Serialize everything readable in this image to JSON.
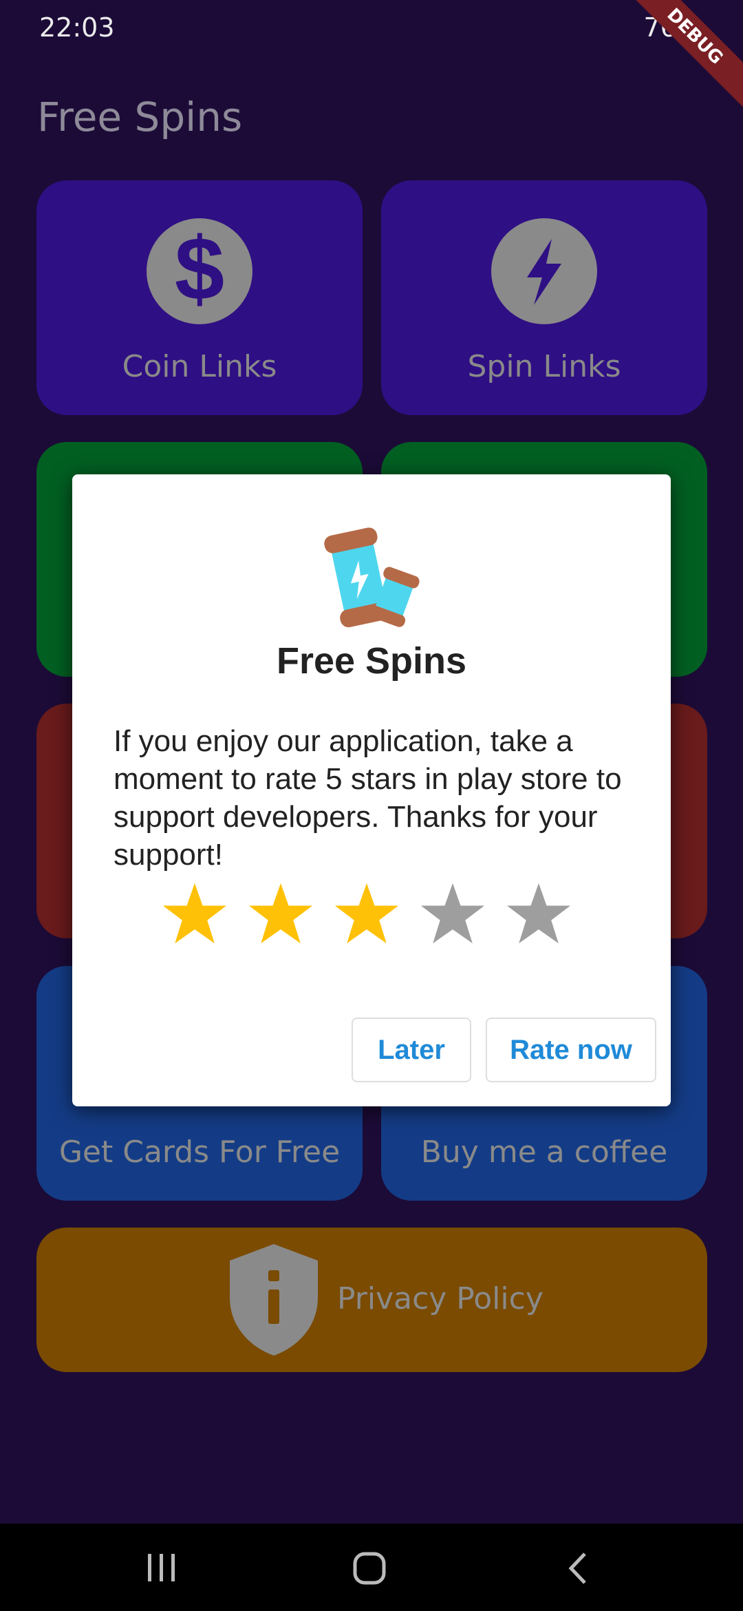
{
  "status_bar": {
    "time": "22:03",
    "battery": "76%",
    "debug_banner": "DEBUG"
  },
  "app": {
    "title": "Free Spins",
    "tiles": [
      {
        "label": "Coin Links",
        "icon": "dollar-icon",
        "color": "#2f0f84"
      },
      {
        "label": "Spin Links",
        "icon": "lightning-icon",
        "color": "#2f0f84"
      },
      {
        "label": "",
        "icon": "",
        "color": "#025f22"
      },
      {
        "label": "",
        "icon": "",
        "color": "#025f22"
      },
      {
        "label": "",
        "icon": "",
        "color": "#6a1b1b"
      },
      {
        "label": "",
        "icon": "",
        "color": "#6a1b1b"
      },
      {
        "label": "Get Cards For Free",
        "icon": "",
        "color": "#143c86"
      },
      {
        "label": "Buy me a coffee",
        "icon": "",
        "color": "#143c86"
      }
    ],
    "privacy": {
      "label": "Privacy Policy",
      "icon": "shield-info-icon",
      "color": "#7a4b00"
    }
  },
  "dialog": {
    "title": "Free Spins",
    "message": "If you enjoy our application, take a moment to rate 5 stars in play store to support developers. Thanks for your support!",
    "rating": 3,
    "max_rating": 5,
    "later_label": "Later",
    "rate_label": "Rate now",
    "star_active_color": "#ffc107",
    "star_inactive_color": "#9e9e9e"
  },
  "navbar": {
    "icons": [
      "recent-apps-icon",
      "home-icon",
      "back-icon"
    ]
  }
}
